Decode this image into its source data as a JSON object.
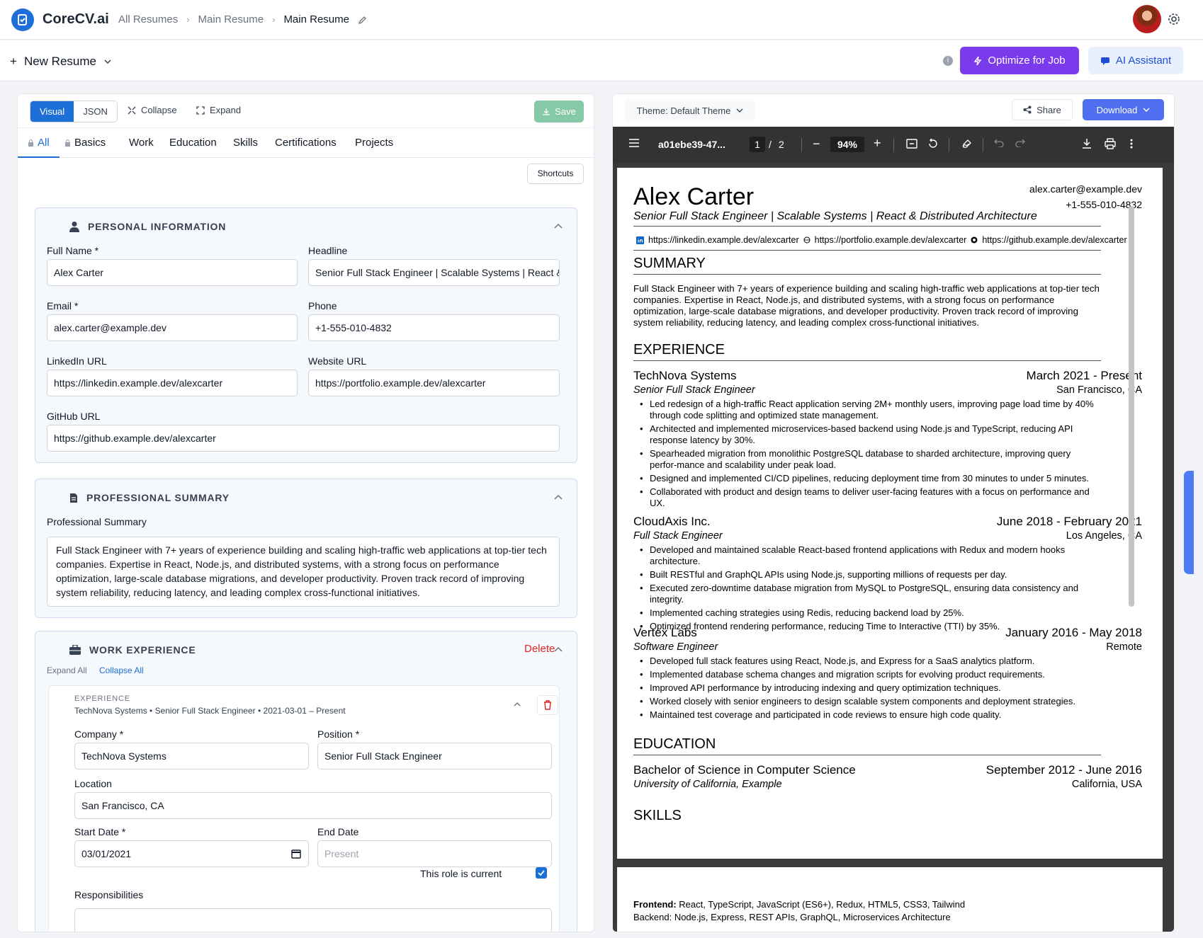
{
  "app": {
    "brand": "CoreCV.ai"
  },
  "breadcrumb": [
    "All Resumes",
    "Main Resume",
    "Main Resume"
  ],
  "toolbar": {
    "new_resume": "New Resume",
    "optimize": "Optimize for Job",
    "assistant": "AI Assistant"
  },
  "editor": {
    "modes": [
      "Visual",
      "JSON"
    ],
    "collapse": "Collapse",
    "expand": "Expand",
    "save": "Save",
    "tabs": [
      "All",
      "Basics",
      "Work",
      "Education",
      "Skills",
      "Certifications",
      "Projects"
    ],
    "shortcuts": "Shortcuts"
  },
  "personal": {
    "title": "PERSONAL INFORMATION",
    "full_name_label": "Full Name *",
    "full_name": "Alex Carter",
    "headline_label": "Headline",
    "headline": "Senior Full Stack Engineer | Scalable Systems | React & Distributed Architecture",
    "email_label": "Email *",
    "email": "alex.carter@example.dev",
    "phone_label": "Phone",
    "phone": "+1-555-010-4832",
    "linkedin_label": "LinkedIn URL",
    "linkedin": "https://linkedin.example.dev/alexcarter",
    "website_label": "Website URL",
    "website": "https://portfolio.example.dev/alexcarter",
    "github_label": "GitHub URL",
    "github": "https://github.example.dev/alexcarter"
  },
  "summary": {
    "title": "PROFESSIONAL SUMMARY",
    "label": "Professional Summary",
    "text": "Full Stack Engineer with 7+ years of experience building and scaling high-traffic web applications at top-tier tech companies. Expertise in React, Node.js, and distributed systems, with a strong focus on performance optimization, large-scale database migrations, and developer productivity. Proven track record of improving system reliability, reducing latency, and leading complex cross-functional initiatives."
  },
  "work": {
    "title": "WORK EXPERIENCE",
    "delete": "Delete",
    "expand_all": "Expand All",
    "collapse_all": "Collapse All",
    "entry": {
      "kicker": "EXPERIENCE",
      "summary": "TechNova Systems • Senior Full Stack Engineer • 2021-03-01 – Present",
      "company_label": "Company *",
      "company": "TechNova Systems",
      "position_label": "Position *",
      "position": "Senior Full Stack Engineer",
      "location_label": "Location",
      "location": "San Francisco, CA",
      "start_label": "Start Date *",
      "start": "03/01/2021",
      "end_label": "End Date",
      "end_placeholder": "Present",
      "current_label": "This role is current",
      "responsibilities_label": "Responsibilities"
    }
  },
  "preview": {
    "theme": "Theme: Default Theme",
    "share": "Share",
    "download": "Download",
    "file": "a01ebe39-47...",
    "page": "1",
    "pages": "2",
    "zoom": "94%"
  },
  "resume": {
    "name": "Alex Carter",
    "headline": "Senior Full Stack Engineer | Scalable Systems | React & Distributed Architecture",
    "email": "alex.carter@example.dev",
    "phone": "+1-555-010-4832",
    "linkedin": "https://linkedin.example.dev/alexcarter",
    "portfolio": "https://portfolio.example.dev/alexcarter",
    "github": "https://github.example.dev/alexcarter",
    "summary_title": "SUMMARY",
    "summary": "Full Stack Engineer with 7+ years of experience building and scaling high-traffic web applications at top-tier tech companies. Expertise in React, Node.js, and distributed systems, with a strong focus on performance optimization, large-scale database migrations, and developer productivity. Proven track record of improving system reliability, reducing latency, and leading complex cross-functional initiatives.",
    "experience_title": "EXPERIENCE",
    "jobs": [
      {
        "company": "TechNova Systems",
        "dates": "March 2021 - Present",
        "role": "Senior Full Stack Engineer",
        "location": "San Francisco, CA",
        "bullets": [
          "Led redesign of a high-traffic React application serving 2M+ monthly users, improving page load time by 40% through code splitting and optimized state management.",
          "Architected and implemented microservices-based backend using Node.js and TypeScript, reducing API response latency by 30%.",
          "Spearheaded migration from monolithic PostgreSQL database to sharded architecture, improving query perfor-mance and scalability under peak load.",
          "Designed and implemented CI/CD pipelines, reducing deployment time from 30 minutes to under 5 minutes.",
          "Collaborated with product and design teams to deliver user-facing features with a focus on performance and UX."
        ]
      },
      {
        "company": "CloudAxis Inc.",
        "dates": "June 2018 - February 2021",
        "role": "Full Stack Engineer",
        "location": "Los Angeles, CA",
        "bullets": [
          "Developed and maintained scalable React-based frontend applications with Redux and modern hooks architecture.",
          "Built RESTful and GraphQL APIs using Node.js, supporting millions of requests per day.",
          "Executed zero-downtime database migration from MySQL to PostgreSQL, ensuring data consistency and integrity.",
          "Implemented caching strategies using Redis, reducing backend load by 25%.",
          "Optimized frontend rendering performance, reducing Time to Interactive (TTI) by 35%."
        ]
      },
      {
        "company": "Vertex Labs",
        "dates": "January 2016 - May 2018",
        "role": "Software Engineer",
        "location": "Remote",
        "bullets": [
          "Developed full stack features using React, Node.js, and Express for a SaaS analytics platform.",
          "Implemented database schema changes and migration scripts for evolving product requirements.",
          "Improved API performance by introducing indexing and query optimization techniques.",
          "Worked closely with senior engineers to design scalable system components and deployment strategies.",
          "Maintained test coverage and participated in code reviews to ensure high code quality."
        ]
      }
    ],
    "education_title": "EDUCATION",
    "degree": "Bachelor of Science in Computer Science",
    "edu_dates": "September 2012 - June 2016",
    "school": "University of California, Example",
    "edu_location": "California, USA",
    "skills_title": "SKILLS",
    "skills_frontend_label": "Frontend:",
    "skills_frontend": "React, TypeScript, JavaScript (ES6+), Redux, HTML5, CSS3, Tailwind",
    "skills_backend_partial": "Backend: Node.js, Express, REST APIs, GraphQL, Microservices Architecture"
  }
}
